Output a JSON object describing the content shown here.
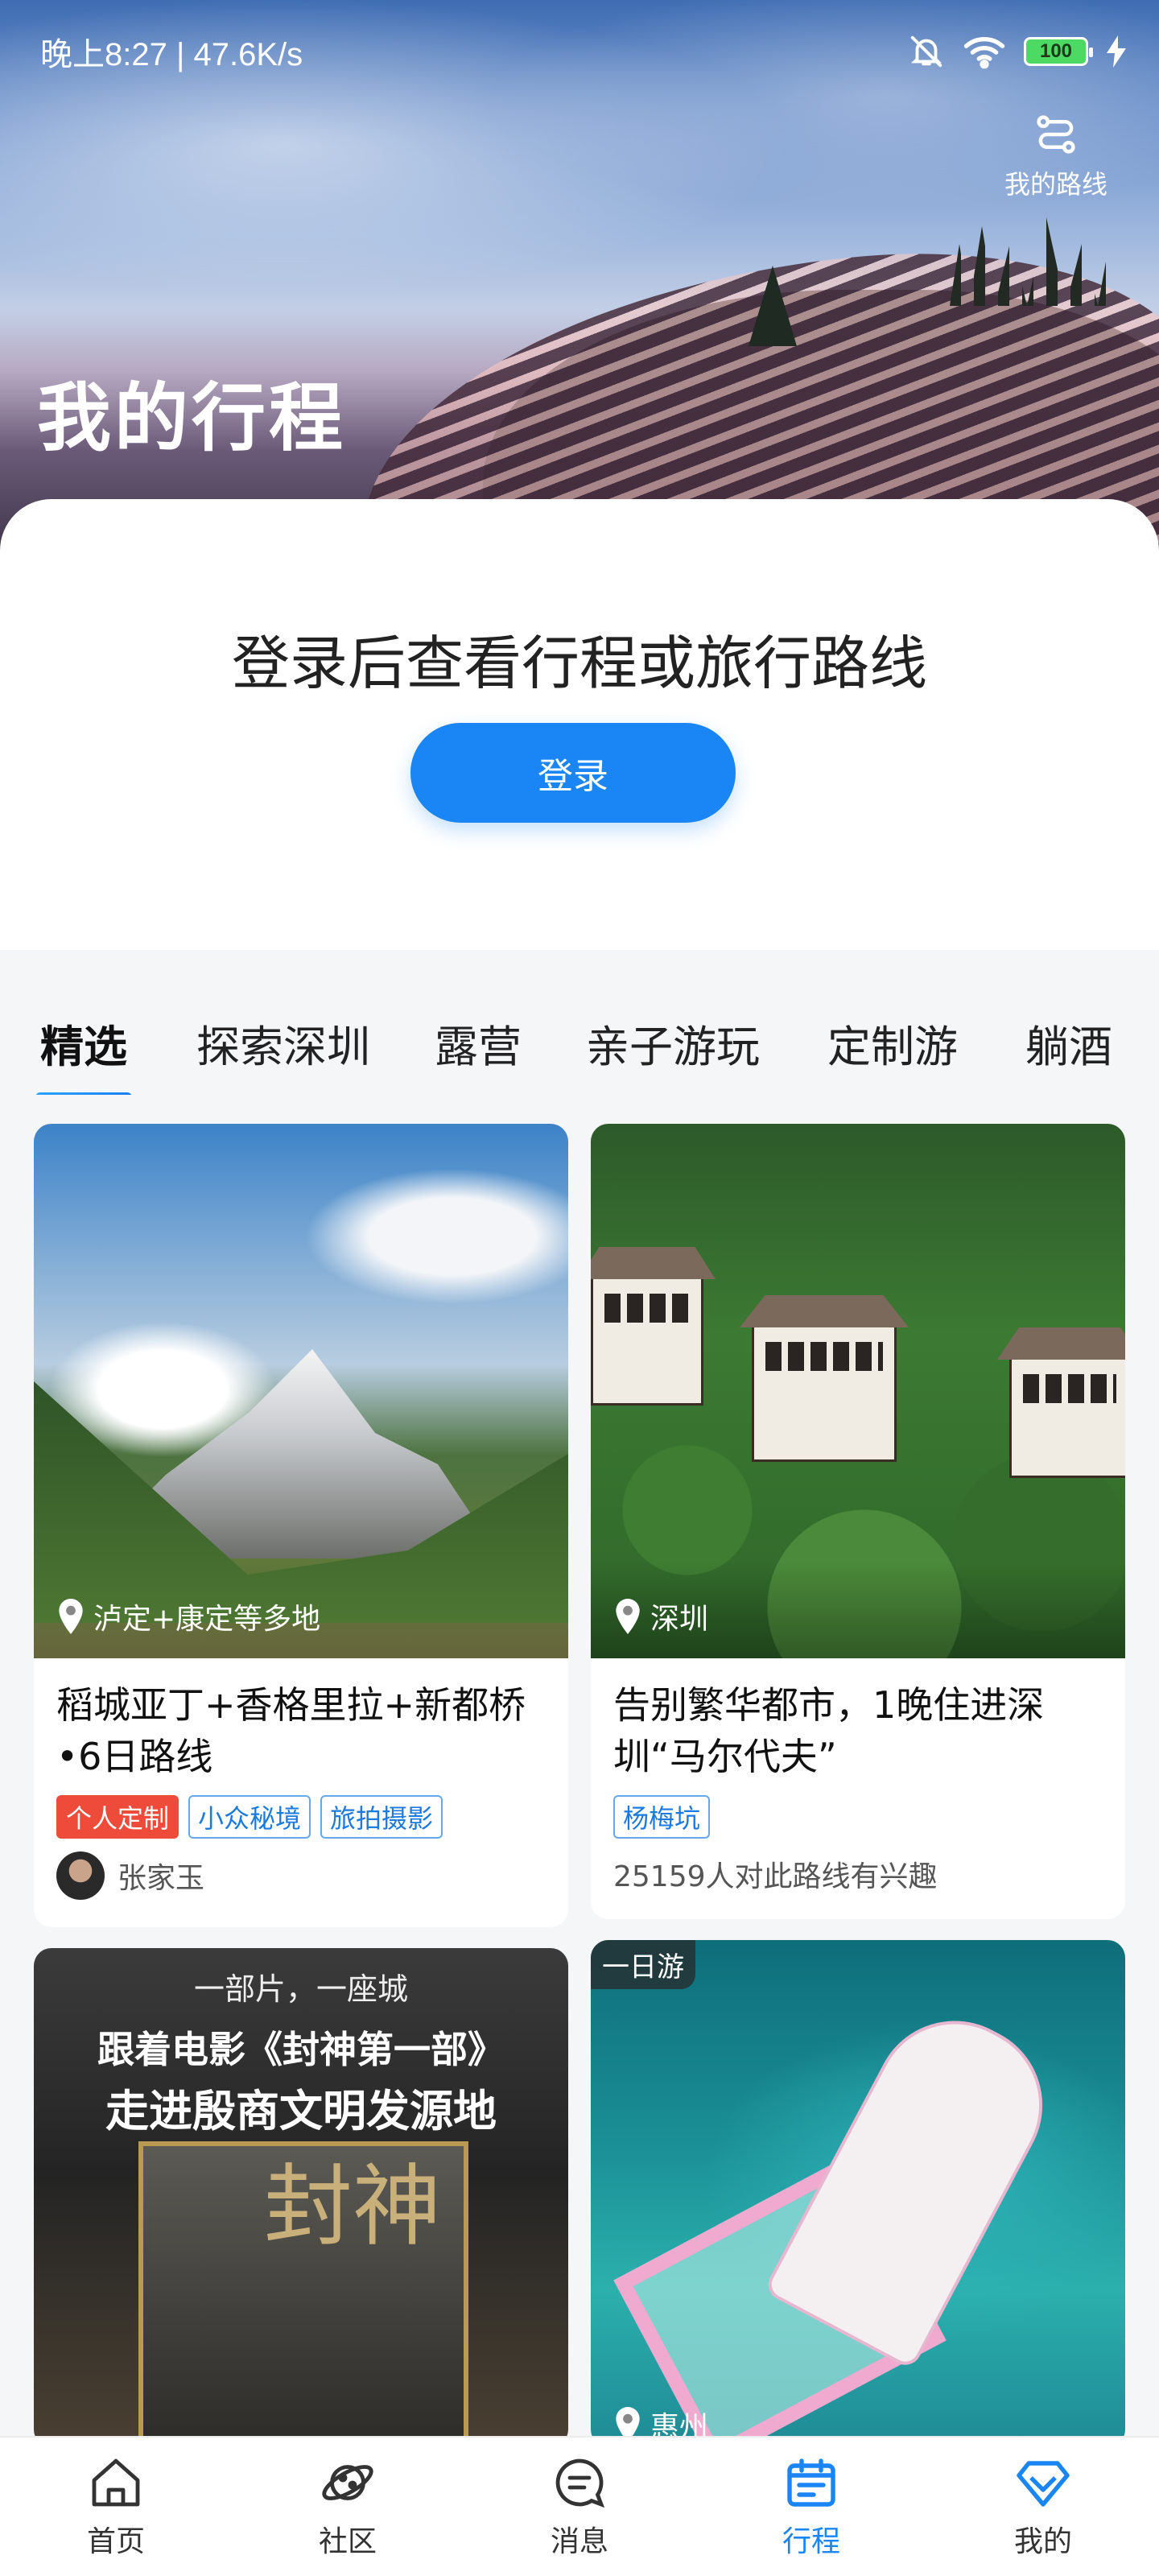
{
  "status_bar": {
    "time_speed": "晚上8:27 | 47.6K/s",
    "battery": "100",
    "icons": [
      "mute-bell-icon",
      "wifi-icon",
      "battery-icon",
      "charging-icon"
    ]
  },
  "header": {
    "title": "我的行程",
    "route_button_label": "我的路线",
    "route_icon": "route-icon"
  },
  "login": {
    "prompt": "登录后查看行程或旅行路线",
    "button_label": "登录"
  },
  "tabs": [
    {
      "label": "精选",
      "active": true
    },
    {
      "label": "探索深圳",
      "active": false
    },
    {
      "label": "露营",
      "active": false
    },
    {
      "label": "亲子游玩",
      "active": false
    },
    {
      "label": "定制游",
      "active": false
    },
    {
      "label": "躺酒",
      "active": false
    }
  ],
  "cards": [
    {
      "location": "泸定+康定等多地",
      "title": "稻城亚丁+香格里拉+新都桥•6日路线",
      "tags": [
        "个人定制",
        "小众秘境",
        "旅拍摄影"
      ],
      "author": "张家玉"
    },
    {
      "location": "深圳",
      "title": "告别繁华都市，1晚住进深圳“马尔代夫”",
      "tags": [
        "杨梅坑"
      ],
      "interest": "25159人对此路线有兴趣"
    },
    {
      "poster_top": "一部片，一座城",
      "poster_line1": "跟着电影《封神第一部》",
      "poster_line2": "走进殷商文明发源地",
      "poster_glyph": "封神"
    },
    {
      "badge": "一日游",
      "location": "惠州"
    }
  ],
  "bottom_nav": [
    {
      "label": "首页",
      "icon": "home-icon",
      "active": false
    },
    {
      "label": "社区",
      "icon": "planet-icon",
      "active": false
    },
    {
      "label": "消息",
      "icon": "message-icon",
      "active": false
    },
    {
      "label": "行程",
      "icon": "calendar-icon",
      "active": true
    },
    {
      "label": "我的",
      "icon": "diamond-icon",
      "active": false
    }
  ],
  "colors": {
    "accent": "#1a86f5",
    "tag_red": "#ef4b3b",
    "tag_blue": "#1a7ae0"
  }
}
